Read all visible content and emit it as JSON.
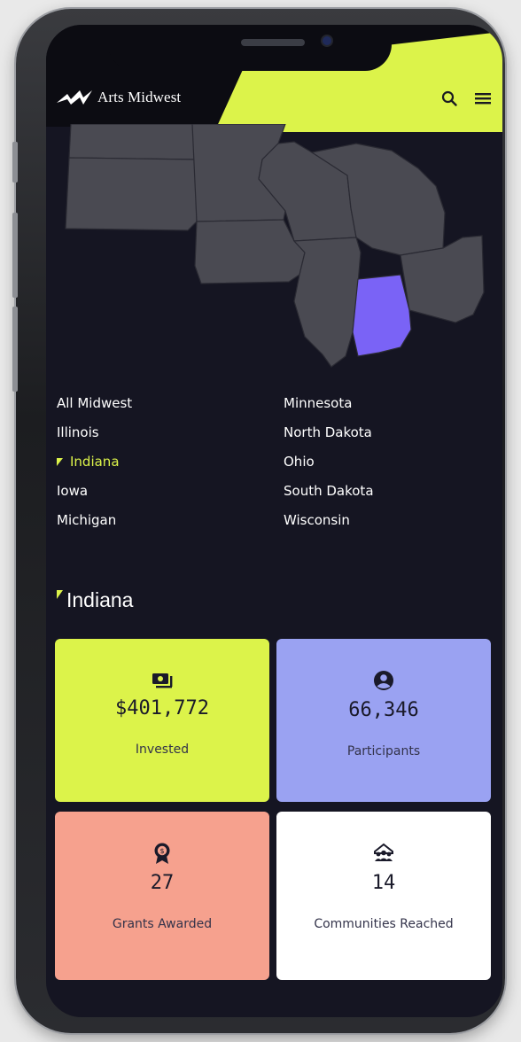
{
  "brand": {
    "name": "Arts Midwest"
  },
  "nav": {
    "search_icon": "search-icon",
    "menu_icon": "hamburger-menu-icon"
  },
  "states": {
    "left": [
      "All Midwest",
      "Illinois",
      "Indiana",
      "Iowa",
      "Michigan"
    ],
    "right": [
      "Minnesota",
      "North Dakota",
      "Ohio",
      "South Dakota",
      "Wisconsin"
    ],
    "selected": "Indiana"
  },
  "section": {
    "title": "Indiana"
  },
  "stats": [
    {
      "value": "$401,772",
      "label": "Invested",
      "icon": "money-icon",
      "color": "#dcf34a"
    },
    {
      "value": "66,346",
      "label": "Participants",
      "icon": "user-icon",
      "color": "#9aa2f2"
    },
    {
      "value": "27",
      "label": "Grants Awarded",
      "icon": "award-badge-icon",
      "color": "#f6a18e"
    },
    {
      "value": "14",
      "label": "Communities Reached",
      "icon": "community-icon",
      "color": "#ffffff"
    }
  ],
  "colors": {
    "accent": "#dcf34a",
    "selected_state": "#7a63f6",
    "map_state": "#4a4a52",
    "background": "#151522"
  }
}
